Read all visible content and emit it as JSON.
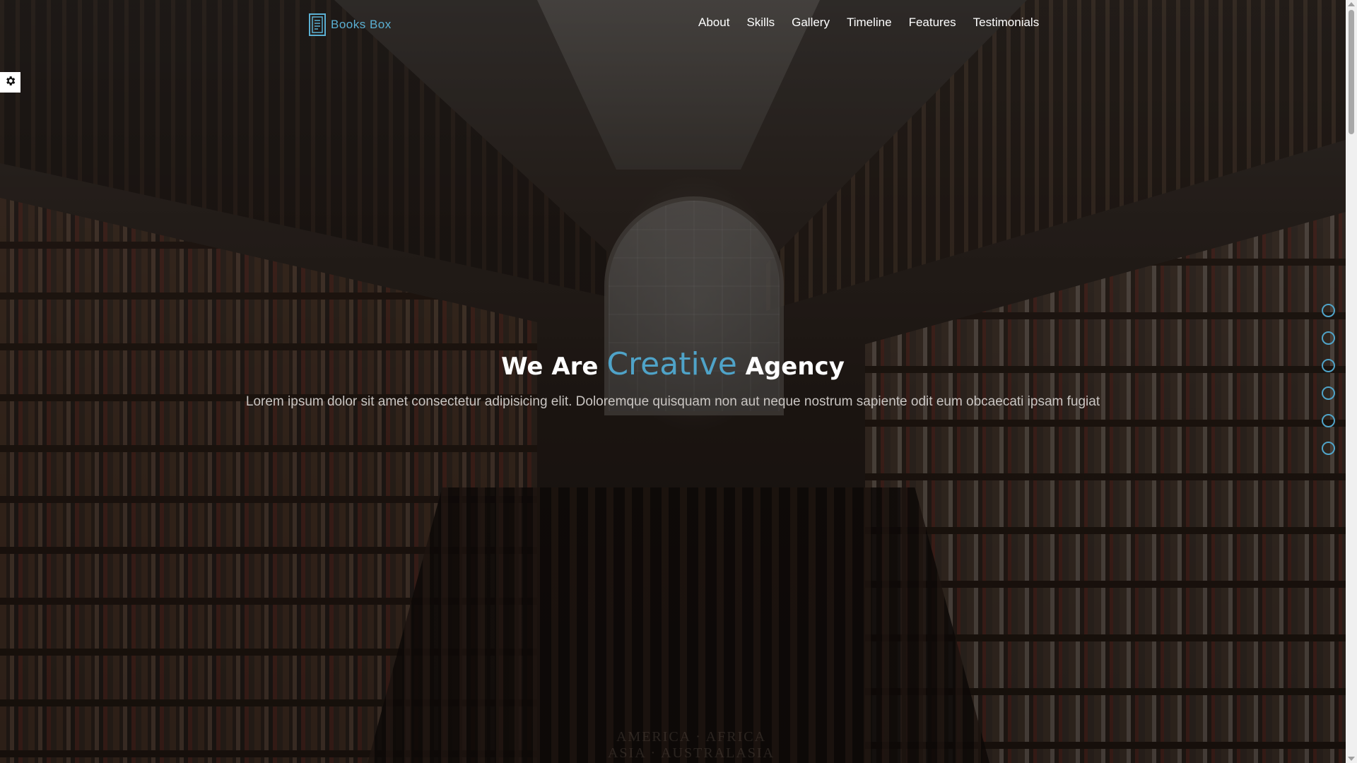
{
  "logo": {
    "text": "Books Box",
    "icon": "book-icon"
  },
  "nav": {
    "items": [
      "About",
      "Skills",
      "Gallery",
      "Timeline",
      "Features",
      "Testimonials"
    ]
  },
  "settings": {
    "icon": "gear-icon"
  },
  "hero": {
    "headline_before": "We Are",
    "headline_accent": "Creative",
    "headline_after": "Agency",
    "subtext": "Lorem ipsum dolor sit amet consectetur adipisicing elit. Doloremque quisquam non aut neque nostrum sapiente odit eum obcaecati ipsam fugiat",
    "background_image": "library-interior",
    "floor_inscription": [
      "AMERICA · AFRICA",
      "ASIA · AUSTRALASIA"
    ]
  },
  "slider": {
    "dot_count": 6
  },
  "colors": {
    "accent": "#4fa3c8",
    "text": "#ffffff",
    "subtext": "#c9c5c2"
  }
}
